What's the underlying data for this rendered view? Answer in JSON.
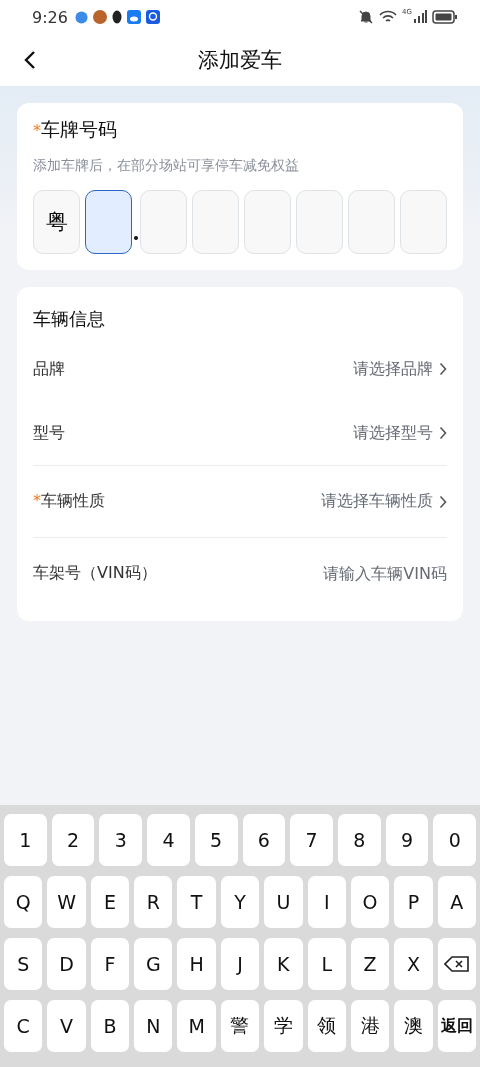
{
  "status_bar": {
    "time": "9:26",
    "network": "4G"
  },
  "header": {
    "title": "添加爱车"
  },
  "plate_card": {
    "title": "车牌号码",
    "required_mark": "*",
    "hint": "添加车牌后，在部分场站可享停车减免权益",
    "cells": [
      {
        "value": "粤",
        "selected": false
      },
      {
        "selected": true
      },
      {
        "selected": false
      },
      {
        "selected": false
      },
      {
        "selected": false
      },
      {
        "selected": false
      },
      {
        "selected": false
      },
      {
        "selected": false
      }
    ]
  },
  "vehicle_card": {
    "title": "车辆信息",
    "rows": [
      {
        "kind": "select",
        "label": "品牌",
        "placeholder": "请选择品牌"
      },
      {
        "kind": "select",
        "label": "型号",
        "placeholder": "请选择型号"
      },
      {
        "kind": "select",
        "label": "车辆性质",
        "required_mark": "*",
        "placeholder": "请选择车辆性质"
      },
      {
        "kind": "input",
        "label": "车架号（VIN码）",
        "placeholder": "请输入车辆VIN码"
      }
    ]
  },
  "keyboard": {
    "rows": [
      {
        "keys": [
          {
            "kind": "char",
            "label": "1"
          },
          {
            "kind": "char",
            "label": "2"
          },
          {
            "kind": "char",
            "label": "3"
          },
          {
            "kind": "char",
            "label": "4"
          },
          {
            "kind": "char",
            "label": "5"
          },
          {
            "kind": "char",
            "label": "6"
          },
          {
            "kind": "char",
            "label": "7"
          },
          {
            "kind": "char",
            "label": "8"
          },
          {
            "kind": "char",
            "label": "9"
          },
          {
            "kind": "char",
            "label": "0"
          }
        ]
      },
      {
        "keys": [
          {
            "kind": "char",
            "label": "Q"
          },
          {
            "kind": "char",
            "label": "W"
          },
          {
            "kind": "char",
            "label": "E"
          },
          {
            "kind": "char",
            "label": "R"
          },
          {
            "kind": "char",
            "label": "T"
          },
          {
            "kind": "char",
            "label": "Y"
          },
          {
            "kind": "char",
            "label": "U"
          },
          {
            "kind": "char",
            "label": "I"
          },
          {
            "kind": "char",
            "label": "O"
          },
          {
            "kind": "char",
            "label": "P"
          },
          {
            "kind": "char",
            "label": "A"
          }
        ]
      },
      {
        "keys": [
          {
            "kind": "char",
            "label": "S"
          },
          {
            "kind": "char",
            "label": "D"
          },
          {
            "kind": "char",
            "label": "F"
          },
          {
            "kind": "char",
            "label": "G"
          },
          {
            "kind": "char",
            "label": "H"
          },
          {
            "kind": "char",
            "label": "J"
          },
          {
            "kind": "char",
            "label": "K"
          },
          {
            "kind": "char",
            "label": "L"
          },
          {
            "kind": "char",
            "label": "Z"
          },
          {
            "kind": "char",
            "label": "X"
          },
          {
            "kind": "backspace"
          }
        ]
      },
      {
        "keys": [
          {
            "kind": "char",
            "label": "C"
          },
          {
            "kind": "char",
            "label": "V"
          },
          {
            "kind": "char",
            "label": "B"
          },
          {
            "kind": "char",
            "label": "N"
          },
          {
            "kind": "char",
            "label": "M"
          },
          {
            "kind": "char",
            "label": "警"
          },
          {
            "kind": "char",
            "label": "学"
          },
          {
            "kind": "char",
            "label": "领"
          },
          {
            "kind": "char",
            "label": "港"
          },
          {
            "kind": "char",
            "label": "澳"
          },
          {
            "kind": "action",
            "label": "返回"
          }
        ]
      }
    ]
  }
}
